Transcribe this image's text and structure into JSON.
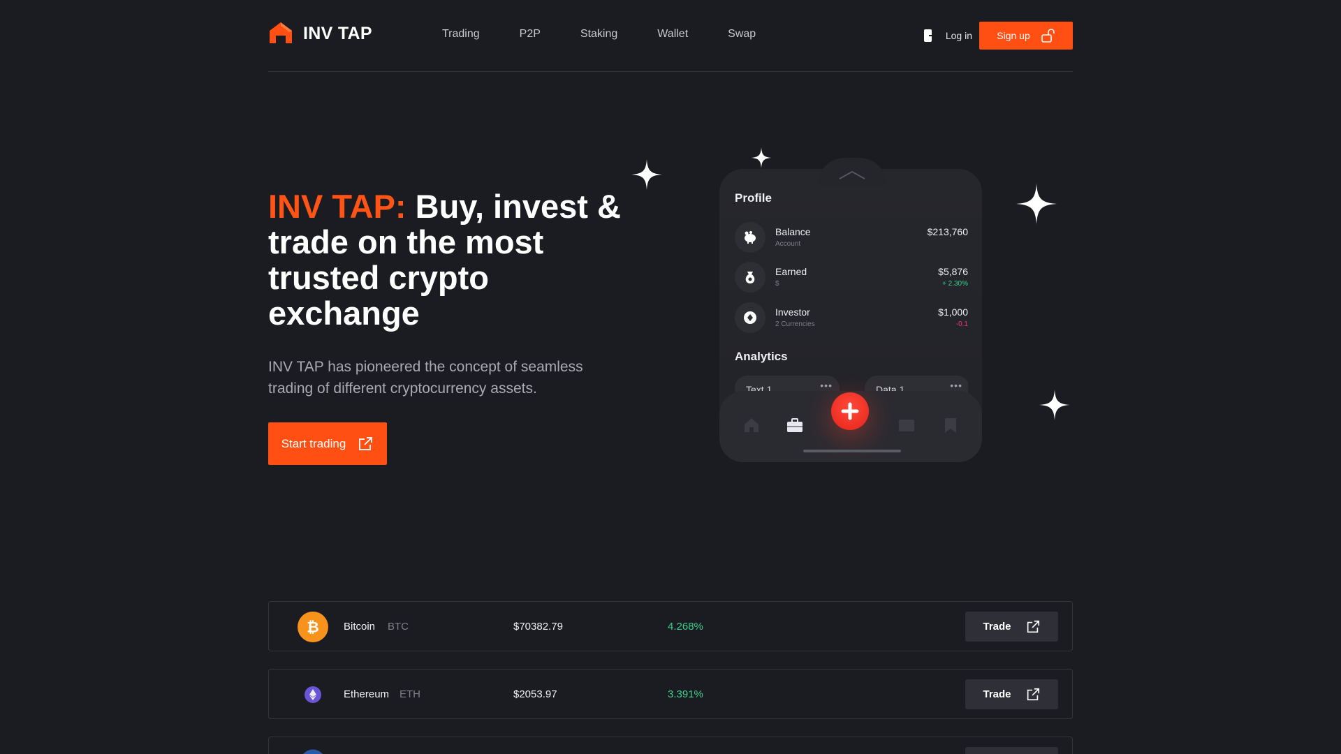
{
  "header": {
    "logo_text": "INV TAP",
    "nav": [
      "Trading",
      "P2P",
      "Staking",
      "Wallet",
      "Swap"
    ],
    "login_label": "Log in",
    "signup_label": "Sign up"
  },
  "hero": {
    "title_accent": "INV TAP:",
    "title_rest": " Buy, invest & trade on the most trusted crypto exchange",
    "subtitle": "INV TAP has pioneered the concept of seamless trading of different cryptocurrency assets.",
    "cta_label": "Start trading"
  },
  "phone": {
    "profile_title": "Profile",
    "rows": [
      {
        "name": "Balance",
        "sub": "Account",
        "value": "$213,760",
        "change": ""
      },
      {
        "name": "Earned",
        "sub": "$",
        "value": "$5,876",
        "change": "+ 2.30%"
      },
      {
        "name": "Investor",
        "sub": "2 Currencies",
        "value": "$1,000",
        "change": "-0.1"
      }
    ],
    "analytics_title": "Analytics",
    "pills": [
      "Text 1",
      "Data 1"
    ]
  },
  "markets": [
    {
      "name": "Bitcoin",
      "symbol": "BTC",
      "price": "$70382.79",
      "change": "4.268%",
      "trade_label": "Trade"
    },
    {
      "name": "Ethereum",
      "symbol": "ETH",
      "price": "$2053.97",
      "change": "3.391%",
      "trade_label": "Trade"
    }
  ],
  "colors": {
    "accent": "#ff4f12",
    "background": "#1b1c21",
    "positive": "#3dd08b",
    "negative": "#ff2d6b"
  }
}
